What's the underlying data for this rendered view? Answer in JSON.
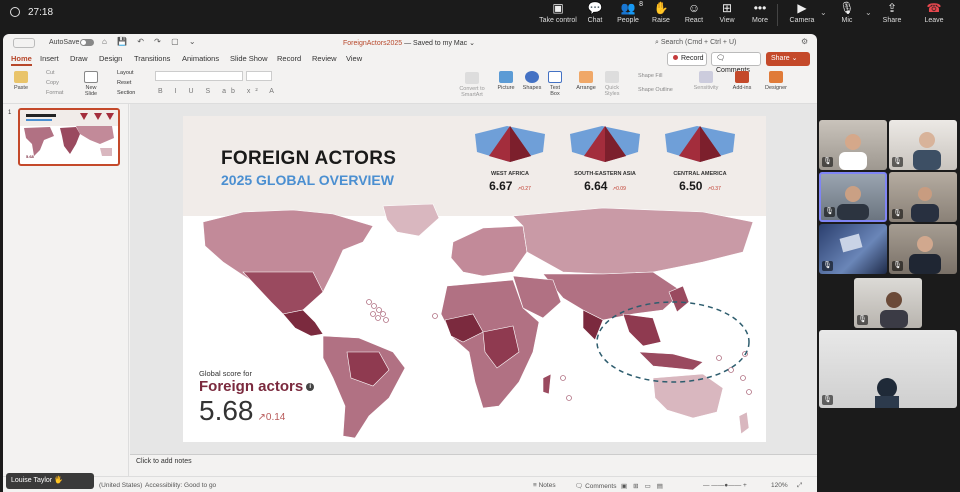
{
  "call": {
    "timer": "27:18",
    "buttons": [
      {
        "label": "Take control",
        "icon": "take-control-icon"
      },
      {
        "label": "Chat",
        "icon": "chat-icon"
      },
      {
        "label": "People",
        "icon": "people-icon",
        "count": "8"
      },
      {
        "label": "Raise",
        "icon": "raise-hand-icon"
      },
      {
        "label": "React",
        "icon": "react-icon"
      },
      {
        "label": "View",
        "icon": "view-icon"
      },
      {
        "label": "More",
        "icon": "more-icon"
      },
      {
        "label": "Camera",
        "icon": "camera-icon"
      },
      {
        "label": "Mic",
        "icon": "mic-off-icon"
      },
      {
        "label": "Share",
        "icon": "share-icon"
      },
      {
        "label": "Leave",
        "icon": "leave-icon"
      }
    ],
    "presenter_name": "Louise Taylor",
    "participant_count": 8
  },
  "ppt": {
    "autosave": "AutoSave",
    "doc_title": "ForeignActors2025",
    "doc_status": "— Saved to my Mac ⌄",
    "search": "Search (Cmd + Ctrl + U)",
    "tabs": [
      "Home",
      "Insert",
      "Draw",
      "Design",
      "Transitions",
      "Animations",
      "Slide Show",
      "Record",
      "Review",
      "View"
    ],
    "record_btn": "Record",
    "comments_btn": "Comments",
    "share_btn": "Share",
    "ribbon": {
      "paste": "Paste",
      "cut": "Cut",
      "copy": "Copy",
      "format": "Format",
      "new_slide": "New Slide",
      "layout": "Layout",
      "reset": "Reset",
      "section": "Section",
      "convert": "Convert to SmartArt",
      "picture": "Picture",
      "shapes": "Shapes",
      "textbox": "Text Box",
      "arrange": "Arrange",
      "quick_styles": "Quick Styles",
      "shape_fill": "Shape Fill",
      "shape_outline": "Shape Outline",
      "sensitivity": "Sensitivity",
      "addins": "Add-ins",
      "designer": "Designer"
    },
    "slide_number": "1",
    "notes_placeholder": "Click to add notes",
    "status": {
      "lang": "(United States)",
      "accessibility": "Accessibility: Good to go",
      "notes": "Notes",
      "comments": "Comments",
      "zoom": "120%"
    }
  },
  "slide": {
    "title": "FOREIGN ACTORS",
    "subtitle": "2025 GLOBAL OVERVIEW",
    "regions": [
      {
        "name": "WEST AFRICA",
        "value": "6.67",
        "delta": "↗0.27"
      },
      {
        "name": "SOUTH-EASTERN ASIA",
        "value": "6.64",
        "delta": "↗0.09"
      },
      {
        "name": "CENTRAL AMERICA",
        "value": "6.50",
        "delta": "↗0.37"
      }
    ],
    "global_label": "Global score for",
    "global_title": "Foreign actors",
    "global_info": "i",
    "global_value": "5.68",
    "global_delta": "↗0.14"
  },
  "colors": {
    "accent": "#b7472a",
    "map_light": "#d9b7bf",
    "map_mid": "#b17183",
    "map_dark": "#7b2a3e",
    "pyramid_blue": "#6f9fd8",
    "pyramid_red": "#a32d3c"
  }
}
